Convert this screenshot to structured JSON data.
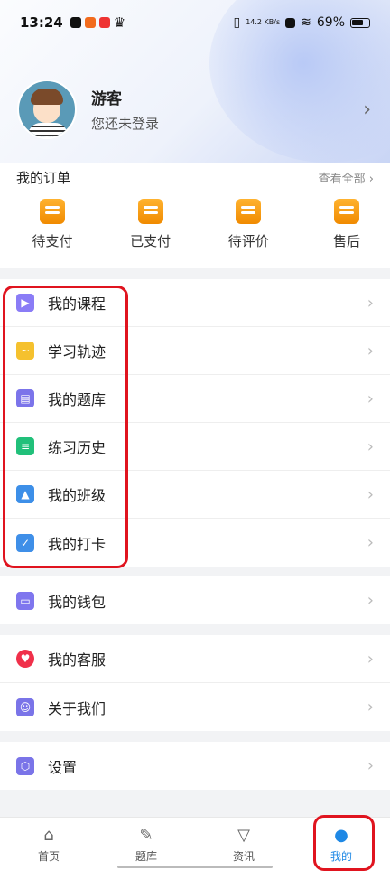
{
  "status_bar": {
    "time": "13:24",
    "speed": "14.2 KB/s",
    "battery": "69%"
  },
  "profile": {
    "name": "游客",
    "subtitle": "您还未登录"
  },
  "orders": {
    "title": "我的订单",
    "view_all": "查看全部",
    "items": [
      {
        "label": "待支付",
        "icon": "wallet-icon"
      },
      {
        "label": "已支付",
        "icon": "paid-icon"
      },
      {
        "label": "待评价",
        "icon": "review-icon"
      },
      {
        "label": "售后",
        "icon": "after-sale-icon"
      }
    ]
  },
  "learning_menu": [
    {
      "label": "我的课程",
      "icon": "course-icon",
      "color": "#8a7cf6"
    },
    {
      "label": "学习轨迹",
      "icon": "trajectory-icon",
      "color": "#f5c12e"
    },
    {
      "label": "我的题库",
      "icon": "question-bank-icon",
      "color": "#7b74ea"
    },
    {
      "label": "练习历史",
      "icon": "practice-history-icon",
      "color": "#21c07a"
    },
    {
      "label": "我的班级",
      "icon": "class-icon",
      "color": "#3d8fe8"
    },
    {
      "label": "我的打卡",
      "icon": "checkin-icon",
      "color": "#3f8fe8"
    }
  ],
  "wallet_menu": [
    {
      "label": "我的钱包",
      "icon": "wallet-icon",
      "color": "#7f76ee"
    }
  ],
  "support_menu": [
    {
      "label": "我的客服",
      "icon": "heart-icon",
      "color": "#f0304a"
    },
    {
      "label": "关于我们",
      "icon": "people-icon",
      "color": "#7a74e8"
    }
  ],
  "settings_menu": [
    {
      "label": "设置",
      "icon": "settings-icon",
      "color": "#7a74e8"
    }
  ],
  "tabbar": [
    {
      "label": "首页",
      "icon": "home-icon",
      "active": false
    },
    {
      "label": "题库",
      "icon": "pencil-icon",
      "active": false
    },
    {
      "label": "资讯",
      "icon": "news-icon",
      "active": false
    },
    {
      "label": "我的",
      "icon": "user-icon",
      "active": true
    }
  ],
  "colors": {
    "highlight": "#e0141f",
    "accent": "#1e88e5",
    "order_icon": "#f59a12"
  }
}
